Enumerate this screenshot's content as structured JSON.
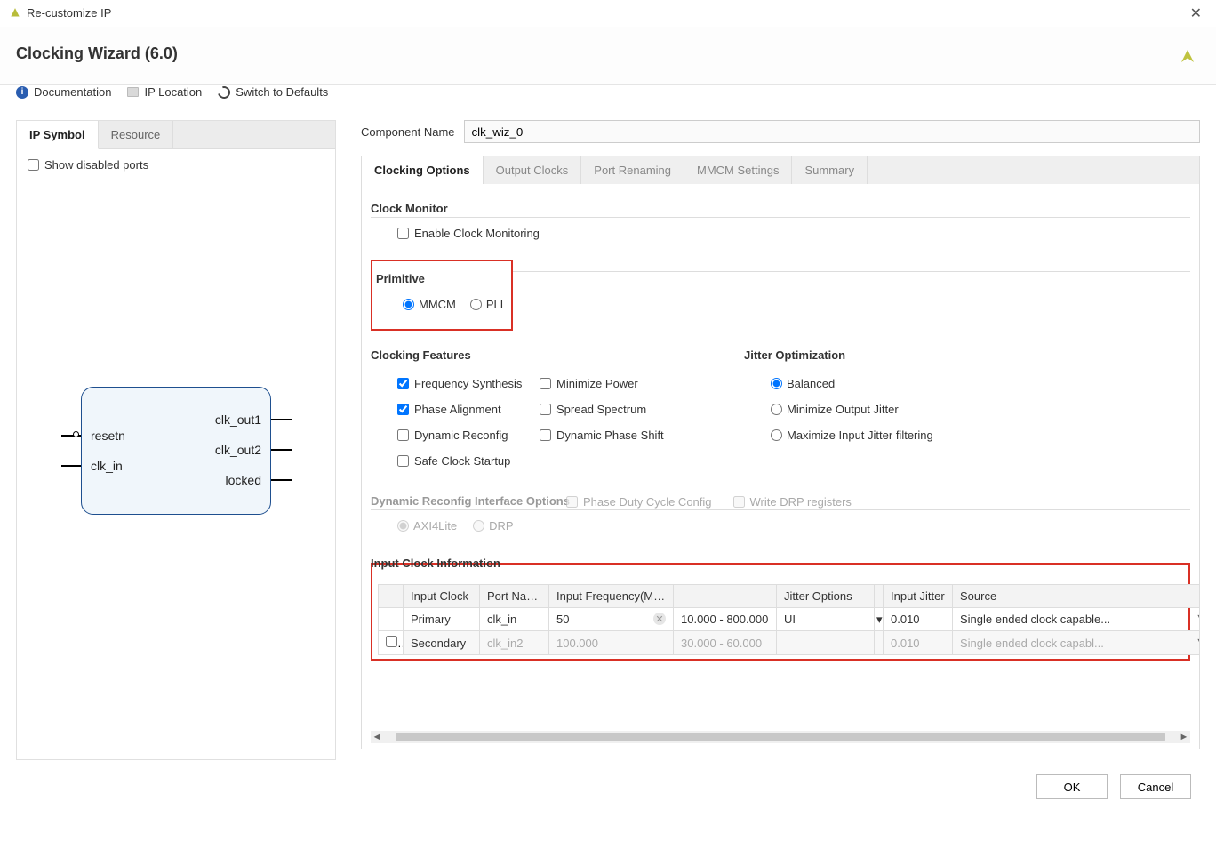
{
  "window": {
    "title": "Re-customize IP"
  },
  "header": {
    "title": "Clocking Wizard (6.0)"
  },
  "toolbar": {
    "doc": "Documentation",
    "iploc": "IP Location",
    "switch": "Switch to Defaults"
  },
  "left": {
    "tabs": [
      "IP Symbol",
      "Resource"
    ],
    "active": 0,
    "show_disabled": "Show disabled ports",
    "ports_left": [
      "resetn",
      "clk_in"
    ],
    "ports_right": [
      "clk_out1",
      "clk_out2",
      "locked"
    ]
  },
  "comp": {
    "label": "Component Name",
    "value": "clk_wiz_0"
  },
  "tabs": [
    "Clocking Options",
    "Output Clocks",
    "Port Renaming",
    "MMCM Settings",
    "Summary"
  ],
  "active_tab": 0,
  "clock_monitor": {
    "title": "Clock Monitor",
    "enable": "Enable Clock Monitoring"
  },
  "primitive": {
    "title": "Primitive",
    "opts": [
      "MMCM",
      "PLL"
    ],
    "sel": "MMCM"
  },
  "features": {
    "title": "Clocking Features",
    "items": [
      {
        "label": "Frequency Synthesis",
        "checked": true
      },
      {
        "label": "Minimize Power",
        "checked": false
      },
      {
        "label": "Phase Alignment",
        "checked": true
      },
      {
        "label": "Spread Spectrum",
        "checked": false
      },
      {
        "label": "Dynamic Reconfig",
        "checked": false
      },
      {
        "label": "Dynamic Phase Shift",
        "checked": false
      },
      {
        "label": "Safe Clock Startup",
        "checked": false
      }
    ]
  },
  "jitter": {
    "title": "Jitter Optimization",
    "opts": [
      "Balanced",
      "Minimize Output Jitter",
      "Maximize Input Jitter filtering"
    ],
    "sel": "Balanced"
  },
  "drio": {
    "title": "Dynamic Reconfig Interface Options",
    "radios": [
      "AXI4Lite",
      "DRP"
    ],
    "checks": [
      "Phase Duty Cycle Config",
      "Write DRP registers"
    ]
  },
  "ic": {
    "title": "Input Clock Information",
    "headers": [
      "",
      "Input Clock",
      "Port Name",
      "Input Frequency(MHz)",
      "",
      "Jitter Options",
      "",
      "Input Jitter",
      "Source"
    ],
    "rows": [
      {
        "en": null,
        "clk": "Primary",
        "port": "clk_in",
        "freq": "50",
        "range": "10.000 - 800.000",
        "jopt": "UI",
        "ij": "0.010",
        "src": "Single ended clock capable..."
      },
      {
        "en": false,
        "clk": "Secondary",
        "port": "clk_in2",
        "freq": "100.000",
        "range": "30.000 - 60.000",
        "jopt": "",
        "ij": "0.010",
        "src": "Single ended clock capabl..."
      }
    ]
  },
  "buttons": {
    "ok": "OK",
    "cancel": "Cancel"
  }
}
